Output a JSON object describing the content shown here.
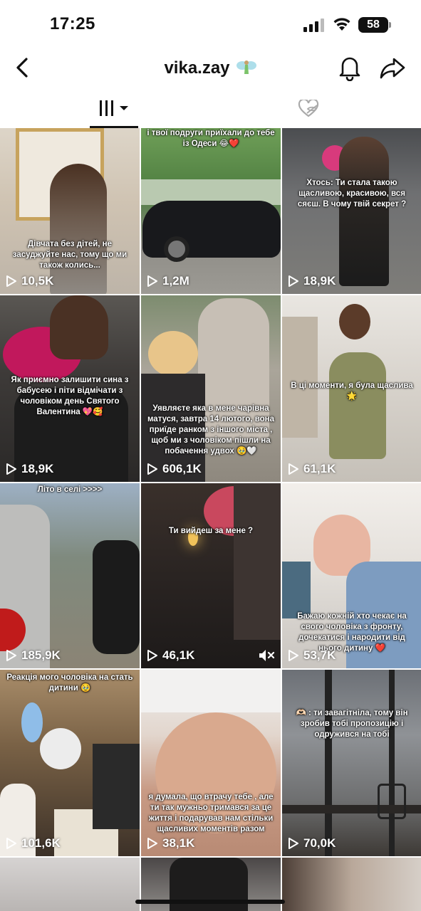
{
  "status": {
    "time": "17:25",
    "battery": "58"
  },
  "header": {
    "username": "vika.zay",
    "emoji_icon": "fairy-icon"
  },
  "tabs": [
    {
      "name": "videos-grid-icon",
      "selected": true
    },
    {
      "name": "liked-hidden-icon",
      "selected": false
    }
  ],
  "videos": [
    {
      "caption": "Дівчата без дітей, не засуджуйте нас, тому що ми також колись...",
      "views": "10,5K"
    },
    {
      "caption": "і твої подруги приїхали до тебе із Одеси 😂❤️",
      "views": "1,2M"
    },
    {
      "caption": "Хтось: Ти стала такою щасливою, красивою, вся сяєш. В чому твій секрет ?",
      "views": "18,9K"
    },
    {
      "caption": "Як приємно залишити сина з бабусею і піти відмічати з чоловіком день Святого Валентина 💖🥰",
      "views": "18,9K"
    },
    {
      "caption": "Уявляєте яка в мене чарівна матуся, завтра 14 лютого, вона приїде ранком з іншого міста , щоб ми з чоловіком пішли на побачення удвох 🥹🤍",
      "views": "606,1K"
    },
    {
      "caption": "В ці моменти, я була щаслива 🌟",
      "views": "61,1K"
    },
    {
      "caption": "Літо в селі >>>>",
      "views": "185,9K"
    },
    {
      "caption": "Ти вийдеш за мене ?",
      "views": "46,1K",
      "muted": true
    },
    {
      "caption": "Бажаю кожній хто чекає на свого чоловіка з фронту, дочекатися і народити від нього дитину ❤️",
      "views": "53,7K"
    },
    {
      "caption": "Реакція мого чоловіка на стать дитини 🥹",
      "views": "101,6K"
    },
    {
      "caption": "я думала, що втрачу тебе , але ти так мужньо тримався за це життя і подарував нам стільки щасливих моментів разом",
      "views": "38,1K"
    },
    {
      "caption": "🫶🏻 : ти завагітніла, тому він зробив тобі пропозицію і одружився на тобі",
      "views": "70,0K"
    }
  ],
  "colors": {
    "text": "#111111",
    "background": "#ffffff",
    "overlay_text": "#ffffff"
  }
}
